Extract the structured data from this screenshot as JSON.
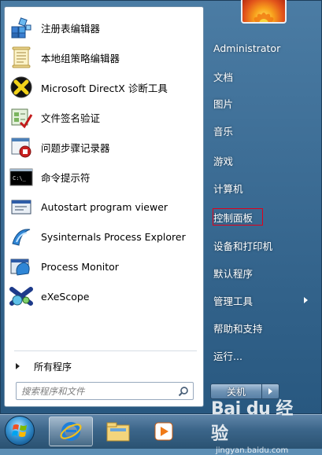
{
  "programs": [
    {
      "label": "注册表编辑器",
      "icon": "registry-editor-icon"
    },
    {
      "label": "本地组策略编辑器",
      "icon": "group-policy-editor-icon"
    },
    {
      "label": "Microsoft DirectX 诊断工具",
      "icon": "directx-diagnostic-icon"
    },
    {
      "label": "文件签名验证",
      "icon": "file-signature-icon"
    },
    {
      "label": "问题步骤记录器",
      "icon": "steps-recorder-icon"
    },
    {
      "label": "命令提示符",
      "icon": "command-prompt-icon"
    },
    {
      "label": "Autostart program viewer",
      "icon": "autostart-viewer-icon"
    },
    {
      "label": "Sysinternals Process Explorer",
      "icon": "process-explorer-icon"
    },
    {
      "label": "Process Monitor",
      "icon": "process-monitor-icon"
    },
    {
      "label": "eXeScope",
      "icon": "exescope-icon"
    }
  ],
  "all_programs_label": "所有程序",
  "search_placeholder": "搜索程序和文件",
  "right_items": [
    {
      "label": "Administrator"
    },
    {
      "label": "文档"
    },
    {
      "label": "图片"
    },
    {
      "label": "音乐"
    },
    {
      "label": "游戏"
    },
    {
      "label": "计算机"
    },
    {
      "label": "控制面板"
    },
    {
      "label": "设备和打印机"
    },
    {
      "label": "默认程序"
    },
    {
      "label": "管理工具"
    },
    {
      "label": "帮助和支持"
    },
    {
      "label": "运行..."
    }
  ],
  "shutdown_label": "关机",
  "cmd_icon_text": "C:\\_",
  "watermark": {
    "logo": "Bai du 经验",
    "url": "jingyan.baidu.com"
  },
  "colors": {
    "highlight_border": "#e0001a",
    "panel_blue": "#3d6a93"
  }
}
